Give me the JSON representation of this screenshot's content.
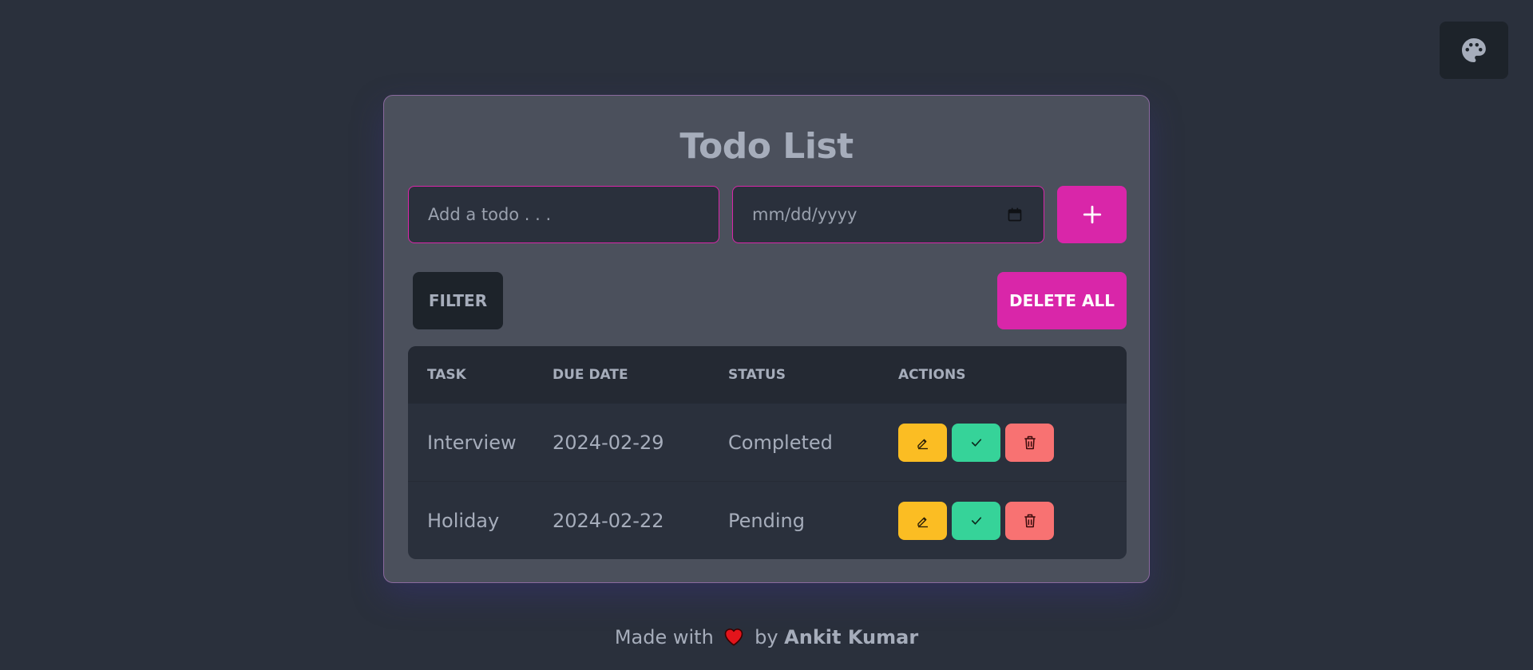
{
  "theme_button": {
    "icon": "palette-icon"
  },
  "title": "Todo List",
  "form": {
    "todo_placeholder": "Add a todo . . .",
    "date_placeholder": "mm/dd/yyyy",
    "add_label": "+"
  },
  "controls": {
    "filter_label": "FILTER",
    "delete_all_label": "DELETE ALL"
  },
  "table": {
    "headers": [
      "TASK",
      "DUE DATE",
      "STATUS",
      "ACTIONS"
    ],
    "rows": [
      {
        "task": "Interview",
        "due": "2024-02-29",
        "status": "Completed"
      },
      {
        "task": "Holiday",
        "due": "2024-02-22",
        "status": "Pending"
      }
    ]
  },
  "footer": {
    "made_with": "Made with",
    "by": "by",
    "author": "Ankit Kumar"
  },
  "colors": {
    "accent": "#d926a9",
    "edit": "#fbbd23",
    "complete": "#36d399",
    "delete": "#f87272"
  }
}
